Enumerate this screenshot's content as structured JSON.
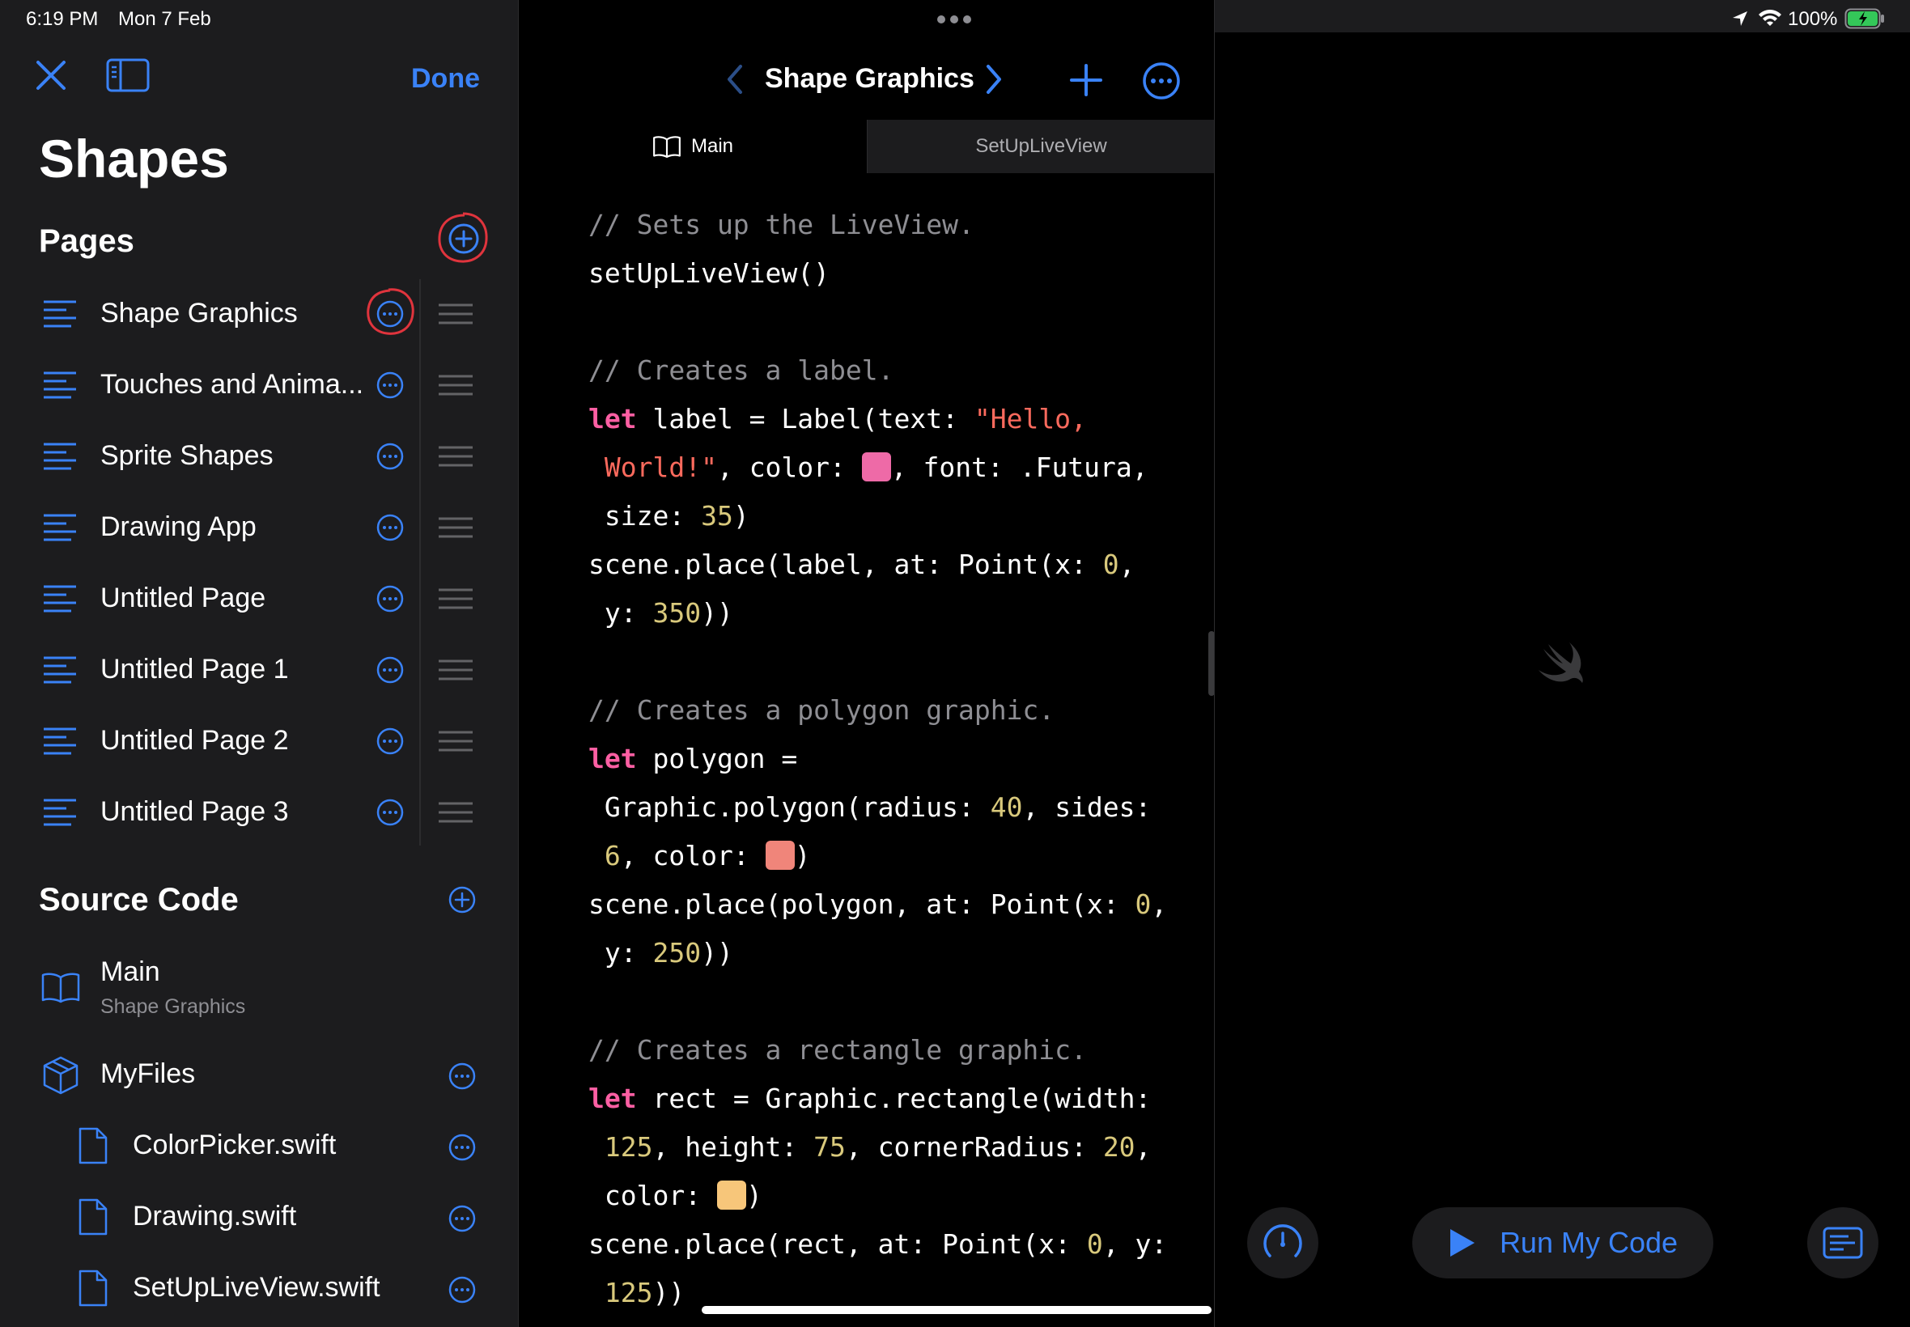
{
  "status_bar": {
    "time": "6:19 PM",
    "date": "Mon 7 Feb",
    "battery": "100%"
  },
  "sidebar": {
    "done_label": "Done",
    "title": "Shapes",
    "pages_header": "Pages",
    "pages": [
      {
        "label": "Shape Graphics"
      },
      {
        "label": "Touches and Anima..."
      },
      {
        "label": "Sprite Shapes"
      },
      {
        "label": "Drawing App"
      },
      {
        "label": "Untitled Page"
      },
      {
        "label": "Untitled Page 1"
      },
      {
        "label": "Untitled Page 2"
      },
      {
        "label": "Untitled Page 3"
      }
    ],
    "source_header": "Source Code",
    "main_item": {
      "label": "Main",
      "sublabel": "Shape Graphics"
    },
    "myfiles_label": "MyFiles",
    "files": [
      {
        "label": "ColorPicker.swift"
      },
      {
        "label": "Drawing.swift"
      },
      {
        "label": "SetUpLiveView.swift"
      }
    ]
  },
  "editor": {
    "title": "Shape Graphics",
    "tabs": [
      {
        "label": "Main"
      },
      {
        "label": "SetUpLiveView"
      }
    ],
    "code": {
      "l1": "// Sets up the LiveView.",
      "l2": "setUpLiveView()",
      "l3": "// Creates a label.",
      "kw_let": "let",
      "l4a": " label = Label(text: ",
      "l4s": "\"Hello,",
      "l5s": " World!\"",
      "l5a": ", color: ",
      "l5b": ", font: .Futura,",
      "l6a": " size: ",
      "l6n": "35",
      "l6b": ")",
      "l7a": "scene.place(label, at: Point(x: ",
      "l7n": "0",
      "l7b": ",",
      "l8a": " y: ",
      "l8n": "350",
      "l8b": "))",
      "l9": "// Creates a polygon graphic.",
      "l10a": " polygon =",
      "l11a": " Graphic.polygon(radius: ",
      "l11n": "40",
      "l11b": ", sides:",
      "l12n": " 6",
      "l12a": ", color: ",
      "l12b": ")",
      "l13a": "scene.place(polygon, at: Point(x: ",
      "l13n": "0",
      "l13b": ",",
      "l14a": " y: ",
      "l14n": "250",
      "l14b": "))",
      "l15": "// Creates a rectangle graphic.",
      "l16a": " rect = Graphic.rectangle(width:",
      "l17n1": " 125",
      "l17a": ", height: ",
      "l17n2": "75",
      "l17b": ", cornerRadius: ",
      "l17n3": "20",
      "l17c": ",",
      "l18a": " color: ",
      "l18b": ")",
      "l19a": "scene.place(rect, at: Point(x: ",
      "l19n": "0",
      "l19b": ", y:",
      "l20n": " 125",
      "l20b": "))"
    },
    "swatches": {
      "label_color": "#ee6aa7",
      "polygon_color": "#f0857a",
      "rect_color": "#f7c67a"
    }
  },
  "live_view": {
    "run_label": "Run My Code"
  },
  "colors": {
    "accent": "#3a82f7",
    "annotation": "#e0343d",
    "sidebar_bg": "#1c1c1e"
  },
  "icons": [
    "close-icon",
    "sidebar-toggle-icon",
    "chevron-left-icon",
    "chevron-right-icon",
    "plus-icon",
    "more-icon",
    "book-icon",
    "page-lines-icon",
    "drag-handle-icon",
    "cube-icon",
    "file-icon",
    "speed-gauge-icon",
    "play-icon",
    "console-icon",
    "swift-logo-icon",
    "wifi-icon",
    "location-icon",
    "battery-icon"
  ]
}
